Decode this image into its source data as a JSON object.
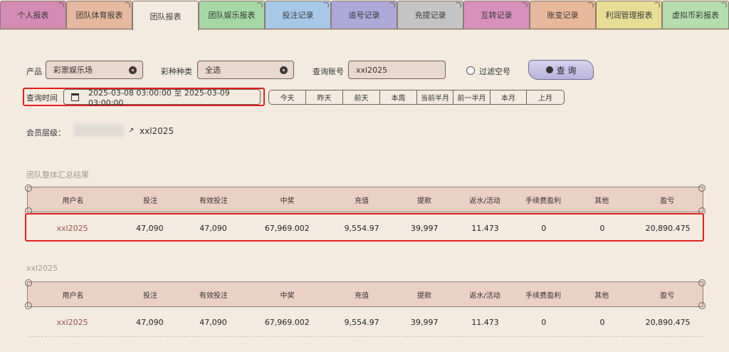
{
  "tabs": [
    {
      "label": "个人报表",
      "color": "#d48bb4"
    },
    {
      "label": "团队体育报表",
      "color": "#e5b89f"
    },
    {
      "label": "团队报表",
      "color": "#f4ebe0"
    },
    {
      "label": "团队娱乐报表",
      "color": "#a6d8a6"
    },
    {
      "label": "投注记录",
      "color": "#a8c8e8"
    },
    {
      "label": "追号记录",
      "color": "#aea8d8"
    },
    {
      "label": "充提记录",
      "color": "#c4c4c4"
    },
    {
      "label": "互转记录",
      "color": "#d890bd"
    },
    {
      "label": "账变记录",
      "color": "#e8b89a"
    },
    {
      "label": "利润管理报表",
      "color": "#e8dd95"
    },
    {
      "label": "虚拟币彩报表",
      "color": "#b6ddb0"
    }
  ],
  "filters": {
    "product_label": "产品",
    "product_value": "彩票娱乐场",
    "lottery_type_label": "彩种种类",
    "lottery_type_value": "全选",
    "account_label": "查询账号",
    "account_value": "xxl2025",
    "filter_empty_label": "过滤空号",
    "query_button": "查 询",
    "time_label": "查询时间",
    "time_range": "2025-03-08 03:00:00 至 2025-03-09 03:00:00",
    "quick_ranges": [
      "今天",
      "昨天",
      "前天",
      "本周",
      "当前半月",
      "前一半月",
      "本月",
      "上月"
    ]
  },
  "member": {
    "label": "会员层级：",
    "path_tail": "xxl2025"
  },
  "summary": {
    "title": "团队整体汇总结果",
    "headers": [
      "用户名",
      "投注",
      "有效投注",
      "中奖",
      "充值",
      "提款",
      "返水/活动",
      "手续费盈利",
      "其他",
      "盈亏"
    ],
    "row": [
      "xxl2025",
      "47,090",
      "47,090",
      "67,969.002",
      "9,554.97",
      "39,997",
      "11.473",
      "0",
      "0",
      "20,890.475"
    ]
  },
  "detail": {
    "title": "xxl2025",
    "headers": [
      "用户名",
      "投注",
      "有效投注",
      "中奖",
      "充值",
      "提款",
      "返水/活动",
      "手续费盈利",
      "其他",
      "盈亏"
    ],
    "row": [
      "xxl2025",
      "47,090",
      "47,090",
      "67,969.002",
      "9,554.97",
      "39,997",
      "11.473",
      "0",
      "0",
      "20,890.475"
    ]
  }
}
